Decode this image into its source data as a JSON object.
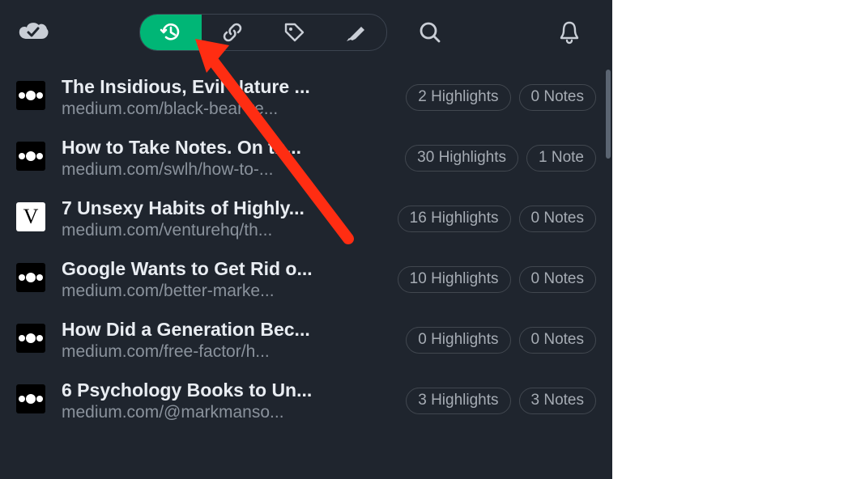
{
  "toolbar": {
    "cloud_name": "sync-icon",
    "segments": [
      {
        "name": "history-icon",
        "active": true
      },
      {
        "name": "link-icon",
        "active": false
      },
      {
        "name": "tag-icon",
        "active": false
      },
      {
        "name": "highlighter-icon",
        "active": false
      }
    ],
    "search_name": "search-icon",
    "bell_name": "bell-icon"
  },
  "items": [
    {
      "favicon": "medium",
      "title": "The Insidious, Evil Nature ...",
      "url": "medium.com/black-bear-re...",
      "highlights": "2 Highlights",
      "notes": "0 Notes"
    },
    {
      "favicon": "medium",
      "title": "How to Take Notes. On th...",
      "url": "medium.com/swlh/how-to-...",
      "highlights": "30 Highlights",
      "notes": "1 Note"
    },
    {
      "favicon": "v",
      "title": "7 Unsexy Habits of Highly...",
      "url": "medium.com/venturehq/th...",
      "highlights": "16 Highlights",
      "notes": "0 Notes"
    },
    {
      "favicon": "medium",
      "title": "Google Wants to Get Rid o...",
      "url": "medium.com/better-marke...",
      "highlights": "10 Highlights",
      "notes": "0 Notes"
    },
    {
      "favicon": "medium",
      "title": "How Did a Generation Bec...",
      "url": "medium.com/free-factor/h...",
      "highlights": "0 Highlights",
      "notes": "0 Notes"
    },
    {
      "favicon": "medium",
      "title": "6 Psychology Books to Un...",
      "url": "medium.com/@markmanso...",
      "highlights": "3 Highlights",
      "notes": "3 Notes"
    }
  ],
  "annotation": {
    "arrow_color": "#ff2d12"
  }
}
